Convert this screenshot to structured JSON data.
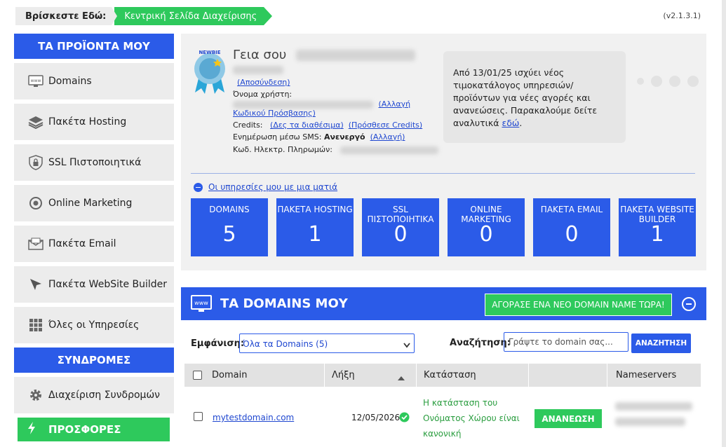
{
  "breadcrumb": {
    "label": "Βρίσκεστε Εδώ:",
    "current": "Κεντρική Σελίδα Διαχείρισης"
  },
  "version": "(v2.1.3.1)",
  "sidebar": {
    "header": "ΤΑ ΠΡΟΪΟΝΤΑ ΜΟΥ",
    "items": [
      {
        "label": "Domains",
        "icon": "monitor-www-icon"
      },
      {
        "label": "Πακέτα Hosting",
        "icon": "layers-icon"
      },
      {
        "label": "SSL Πιστοποιητικά",
        "icon": "shield-lock-icon"
      },
      {
        "label": "Online Marketing",
        "icon": "target-icon"
      },
      {
        "label": "Πακέτα Email",
        "icon": "envelope-icon"
      },
      {
        "label": "Πακέτα WebSite Builder",
        "icon": "cursor-icon"
      },
      {
        "label": "Όλες οι Υπηρεσίες",
        "icon": "grid-icon"
      }
    ],
    "subs_header": "ΣΥΝΔΡΟΜΕΣ",
    "subs_item": "Διαχείριση Συνδρομών",
    "offers": "ΠΡΟΣΦΟΡΕΣ"
  },
  "account": {
    "badge": "NEWBIE",
    "greeting": "Γεια σου",
    "logout": "(Αποσύνδεση)",
    "username_label": "Όνομα χρήστη:",
    "change": "(Αλλαγή",
    "change_pw": "Κωδικού Πρόσβασης)",
    "credits_label": "Credits:",
    "see_available": "(Δες τα διαθέσιμα)",
    "add_credits": "(Πρόσθεσε Credits)",
    "sms_label": "Ενημέρωση μέσω SMS:",
    "sms_status": "Ανενεργό",
    "sms_change": "(Αλλαγή)",
    "email_label": "Κωδ. Ηλεκτρ. Πληρωμών:"
  },
  "notice": {
    "text": "Από 13/01/25 ισχύει νέος τιμοκατάλογος υπηρεσιών/ προϊόντων για νέες αγορές και ανανεώσεις. Παρακαλούμε δείτε αναλυτικά",
    "link": "εδώ",
    "end": "."
  },
  "glance": "Οι υπηρεσίες μου με μια ματιά",
  "tiles": [
    {
      "title": "DOMAINS",
      "count": "5"
    },
    {
      "title": "ΠΑΚΕΤΑ HOSTING",
      "count": "1"
    },
    {
      "title": "SSL ΠΙΣΤΟΠΟΙΗΤΙΚΑ",
      "count": "0"
    },
    {
      "title": "ONLINE MARKETING",
      "count": "0"
    },
    {
      "title": "ΠΑΚΕΤΑ EMAIL",
      "count": "0"
    },
    {
      "title": "ΠΑΚΕΤΑ WEBSITE BUILDER",
      "count": "1"
    }
  ],
  "domains": {
    "title": "ΤΑ DOMAINS ΜΟΥ",
    "buy": "ΑΓΟΡΑΣΕ ΕΝΑ ΝΕΟ DOMAIN NAME ΤΩΡΑ!",
    "show_label": "Εμφάνιση:",
    "show_value": "Όλα τα Domains (5)",
    "search_label": "Αναζήτηση:",
    "search_placeholder": "Γράψτε το domain σας...",
    "search_btn": "ΑΝΑΖΗΤΗΣΗ",
    "columns": [
      "Domain",
      "Λήξη",
      "Κατάσταση",
      "",
      "Nameservers"
    ],
    "row": {
      "domain": "mytestdomain.com",
      "expiry": "12/05/2026",
      "status": "Η κατάσταση του Ονόματος Χώρου είναι κανονική",
      "action": "ΑΝΑΝΕΩΣΗ"
    }
  },
  "colors": {
    "blue": "#2b5be8",
    "green": "#2ec95c"
  }
}
